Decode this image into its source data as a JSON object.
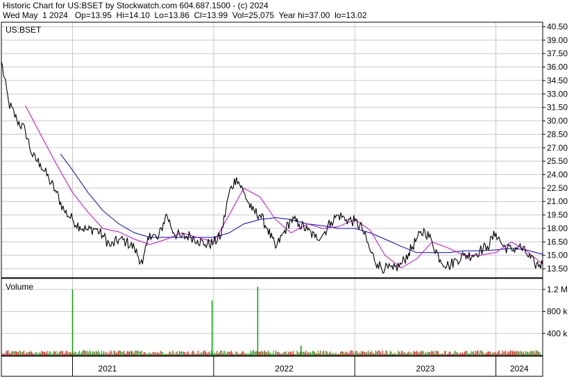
{
  "header": {
    "line1": "Historic Chart for US:BSET by Stockwatch.com 604.687.1500 - (c) 2024",
    "line2": "Wed May  1 2024   Op=13.95  Hi=14.10  Lo=13.86  Cl=13.99  Vol=25,075  Year hi=37.00  lo=13.02"
  },
  "colors": {
    "price": "#000000",
    "ma_short": "#cc00cc",
    "ma_long": "#0000cc",
    "vol_up": "#00a000",
    "vol_down": "#dd0000",
    "grid": "#c8c8c8",
    "frame": "#000000"
  },
  "chart_data": [
    {
      "type": "line",
      "panel_label": "US:BSET",
      "y_ticks": [
        "40.50",
        "39.00",
        "37.50",
        "36.00",
        "34.50",
        "33.00",
        "31.50",
        "30.00",
        "28.50",
        "27.00",
        "25.50",
        "24.00",
        "22.50",
        "21.00",
        "19.50",
        "18.00",
        "16.50",
        "15.00",
        "13.50"
      ],
      "ylim": [
        12.5,
        41.0
      ],
      "x_ticks": [
        "2021",
        "2022",
        "2023",
        "2024"
      ],
      "x_tick_positions": [
        "2021-01-01",
        "2022-01-01",
        "2023-01-01",
        "2024-01-01"
      ],
      "xlim": [
        "2020-07-01",
        "2024-05-01"
      ],
      "grid": true,
      "series": [
        {
          "style": "black-price",
          "x": [
            "2020-07-01",
            "2020-07-20",
            "2020-08-10",
            "2020-09-01",
            "2020-09-20",
            "2020-10-10",
            "2020-11-01",
            "2020-11-20",
            "2020-12-10",
            "2021-01-01",
            "2021-01-20",
            "2021-02-10",
            "2021-03-01",
            "2021-03-20",
            "2021-04-10",
            "2021-05-01",
            "2021-05-20",
            "2021-06-10",
            "2021-07-01",
            "2021-07-20",
            "2021-08-10",
            "2021-09-01",
            "2021-09-20",
            "2021-10-10",
            "2021-11-01",
            "2021-11-20",
            "2021-12-10",
            "2022-01-01",
            "2022-01-20",
            "2022-02-10",
            "2022-03-01",
            "2022-03-20",
            "2022-04-10",
            "2022-05-01",
            "2022-05-20",
            "2022-06-10",
            "2022-07-01",
            "2022-07-20",
            "2022-08-10",
            "2022-09-01",
            "2022-09-20",
            "2022-10-10",
            "2022-11-01",
            "2022-11-20",
            "2022-12-10",
            "2023-01-01",
            "2023-01-20",
            "2023-02-10",
            "2023-03-01",
            "2023-03-20",
            "2023-04-10",
            "2023-05-01",
            "2023-05-20",
            "2023-06-10",
            "2023-07-01",
            "2023-07-20",
            "2023-08-10",
            "2023-09-01",
            "2023-09-20",
            "2023-10-10",
            "2023-11-01",
            "2023-11-20",
            "2023-12-10",
            "2024-01-01",
            "2024-01-20",
            "2024-02-10",
            "2024-03-01",
            "2024-03-20",
            "2024-04-10",
            "2024-05-01"
          ],
          "values": [
            36.6,
            32.0,
            30.1,
            28.9,
            26.0,
            25.2,
            23.5,
            22.0,
            20.0,
            19.0,
            18.2,
            17.8,
            18.0,
            17.2,
            16.0,
            16.8,
            16.5,
            15.8,
            14.0,
            17.5,
            16.8,
            19.6,
            17.5,
            17.0,
            17.2,
            16.7,
            16.2,
            16.4,
            17.2,
            22.0,
            23.7,
            22.0,
            20.0,
            19.5,
            18.0,
            15.8,
            17.5,
            19.0,
            18.5,
            17.8,
            17.0,
            17.3,
            18.8,
            19.5,
            19.0,
            18.8,
            18.0,
            15.5,
            14.0,
            13.5,
            13.4,
            14.0,
            15.2,
            16.8,
            17.8,
            16.5,
            14.5,
            13.8,
            14.5,
            15.0,
            15.0,
            15.5,
            16.0,
            17.5,
            16.0,
            15.6,
            16.0,
            15.2,
            14.0,
            13.99
          ]
        },
        {
          "style": "magenta-ma",
          "x": [
            "2020-09-01",
            "2020-10-10",
            "2020-11-20",
            "2021-01-01",
            "2021-02-10",
            "2021-03-20",
            "2021-05-01",
            "2021-06-10",
            "2021-07-20",
            "2021-09-01",
            "2021-10-10",
            "2021-11-20",
            "2022-01-01",
            "2022-02-10",
            "2022-03-20",
            "2022-05-01",
            "2022-06-10",
            "2022-07-20",
            "2022-09-01",
            "2022-10-10",
            "2022-11-20",
            "2023-01-01",
            "2023-02-10",
            "2023-03-20",
            "2023-05-01",
            "2023-06-10",
            "2023-07-20",
            "2023-09-01",
            "2023-10-10",
            "2023-11-20",
            "2024-01-01",
            "2024-02-10",
            "2024-03-20",
            "2024-05-01"
          ],
          "values": [
            31.7,
            28.5,
            25.2,
            22.0,
            19.8,
            18.0,
            17.6,
            16.8,
            16.2,
            16.8,
            17.5,
            17.0,
            16.5,
            19.5,
            22.5,
            21.5,
            19.0,
            17.5,
            18.5,
            18.0,
            18.2,
            19.0,
            17.8,
            15.0,
            13.6,
            14.6,
            16.5,
            15.8,
            15.0,
            15.0,
            15.3,
            16.5,
            15.5,
            14.0
          ]
        },
        {
          "style": "blue-ma",
          "x": [
            "2020-12-01",
            "2021-01-01",
            "2021-02-10",
            "2021-03-20",
            "2021-05-01",
            "2021-06-10",
            "2021-07-20",
            "2021-09-01",
            "2021-10-10",
            "2021-11-20",
            "2022-01-01",
            "2022-02-10",
            "2022-03-20",
            "2022-05-01",
            "2022-06-10",
            "2022-07-20",
            "2022-09-01",
            "2022-10-10",
            "2022-11-20",
            "2023-01-01",
            "2023-02-10",
            "2023-03-20",
            "2023-05-01",
            "2023-06-10",
            "2023-07-20",
            "2023-09-01",
            "2023-10-10",
            "2023-11-20",
            "2024-01-01",
            "2024-02-10",
            "2024-03-20",
            "2024-05-01"
          ],
          "values": [
            26.3,
            24.5,
            22.0,
            20.0,
            18.5,
            17.5,
            17.0,
            17.0,
            17.0,
            17.0,
            17.0,
            17.5,
            18.5,
            19.0,
            19.2,
            19.0,
            18.5,
            18.3,
            18.0,
            18.0,
            17.5,
            16.8,
            16.0,
            15.3,
            15.3,
            15.3,
            15.5,
            15.5,
            15.6,
            15.8,
            15.6,
            15.1
          ]
        }
      ]
    },
    {
      "type": "bar",
      "panel_label": "Volume",
      "y_ticks": [
        "1.2 M",
        "800 k",
        "400 k"
      ],
      "ylim": [
        0,
        1400000
      ],
      "x_ticks": [
        "2021",
        "2022",
        "2023",
        "2024"
      ],
      "spikes": [
        {
          "date": "2021-01-01",
          "volume": 1200000
        },
        {
          "date": "2021-12-28",
          "volume": 1000000
        },
        {
          "date": "2022-04-25",
          "volume": 1250000
        },
        {
          "date": "2022-08-15",
          "volume": 180000
        }
      ],
      "typical_volume": 60000
    }
  ]
}
